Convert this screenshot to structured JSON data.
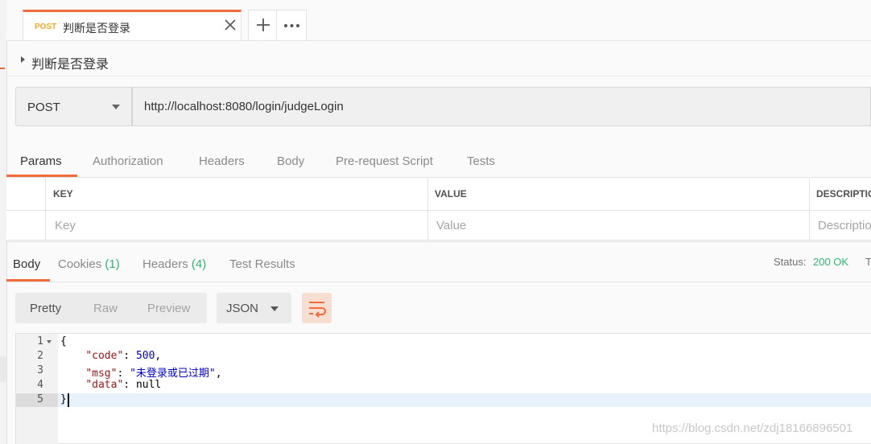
{
  "tab": {
    "method": "POST",
    "name": "判断是否登录",
    "add_label": "+",
    "more_label": "•••"
  },
  "request": {
    "title": "判断是否登录",
    "method": "POST",
    "url": "http://localhost:8080/login/judgeLogin"
  },
  "request_tabs": [
    "Params",
    "Authorization",
    "Headers",
    "Body",
    "Pre-request Script",
    "Tests"
  ],
  "params": {
    "headers": {
      "key": "KEY",
      "value": "VALUE",
      "description": "DESCRIPTIC"
    },
    "placeholders": {
      "key": "Key",
      "value": "Value",
      "description": "Descriptio"
    }
  },
  "response_tabs": {
    "body": "Body",
    "cookies": "Cookies",
    "cookies_count": "(1)",
    "headers": "Headers",
    "headers_count": "(4)",
    "test_results": "Test Results"
  },
  "status": {
    "label": "Status:",
    "value": "200 OK",
    "more": "T"
  },
  "view_modes": [
    "Pretty",
    "Raw",
    "Preview"
  ],
  "format": "JSON",
  "body": {
    "line_numbers": [
      "1",
      "2",
      "3",
      "4",
      "5"
    ],
    "open": "{",
    "code_key": "\"code\"",
    "code_value": "500",
    "msg_key": "\"msg\"",
    "msg_value": "\"未登录或已过期\"",
    "data_key": "\"data\"",
    "data_value": "null",
    "close": "}"
  },
  "watermark": "https://blog.csdn.net/zdj18166896501",
  "colors": {
    "accent": "#f26b3a",
    "success": "#2bb673",
    "method_tab": "#f5a623"
  }
}
